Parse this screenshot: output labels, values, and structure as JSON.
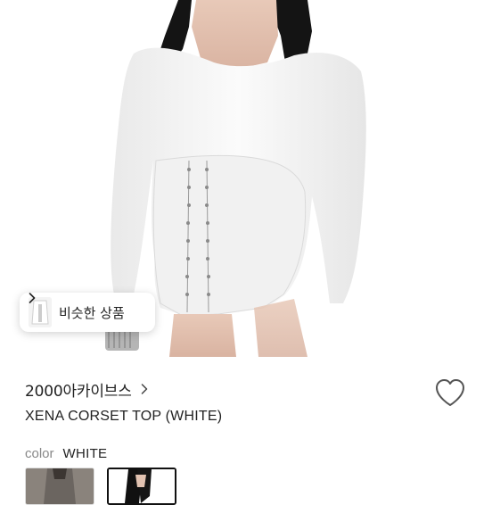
{
  "product": {
    "similar_button_label": "비슷한 상품",
    "shop_name": "2000아카이브스",
    "title": "XENA CORSET TOP (WHITE)",
    "color_label": "color",
    "color_value": "WHITE"
  },
  "icons": {
    "similar_chevron": "chevron-right-icon",
    "shop_chevron": "chevron-right-icon",
    "wishlist": "heart-outline-icon"
  },
  "colors": {
    "background": "#ffffff",
    "text": "#222222",
    "muted": "#888888",
    "selected_border": "#111111"
  }
}
